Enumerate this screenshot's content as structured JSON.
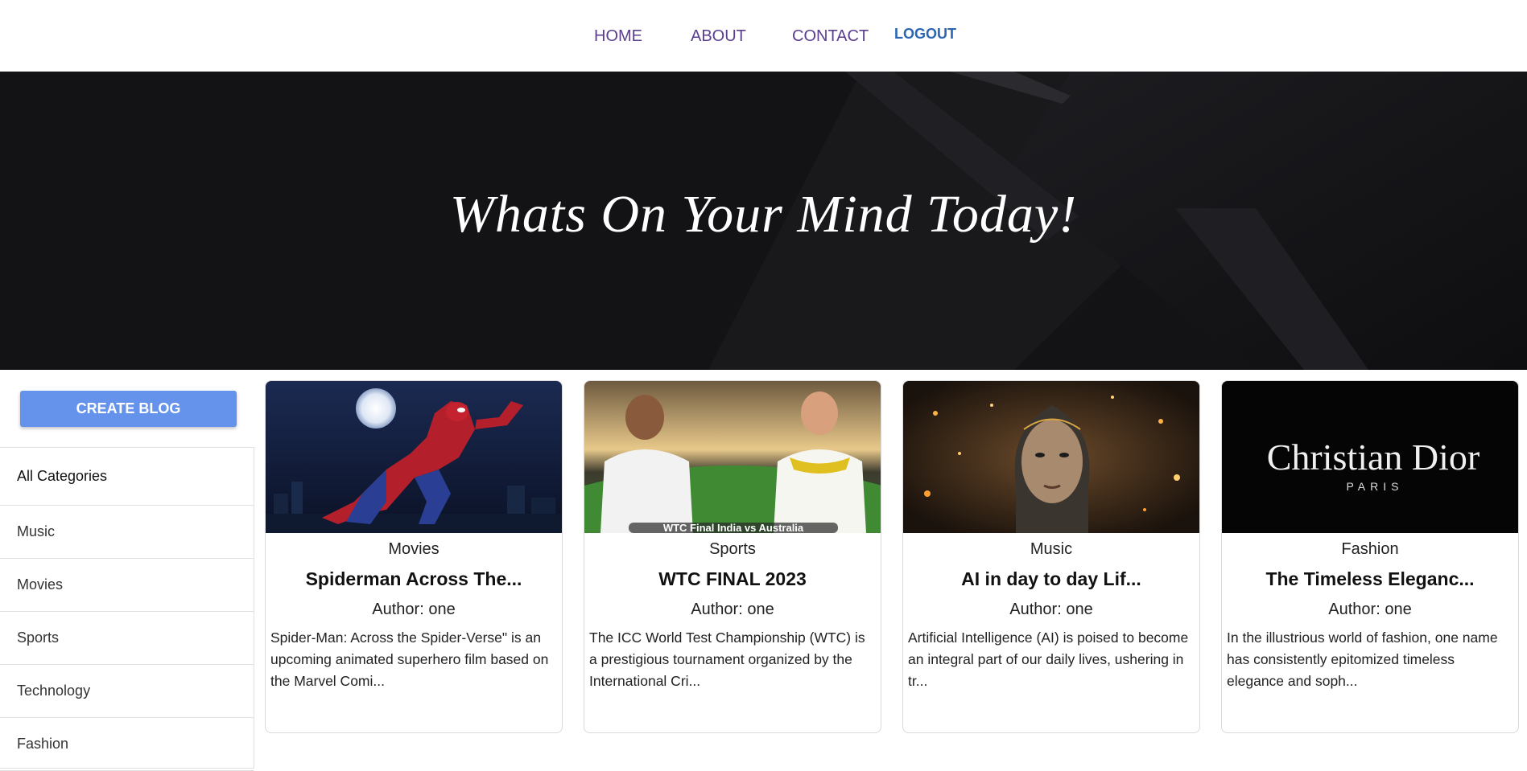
{
  "nav": {
    "home": "HOME",
    "about": "ABOUT",
    "contact": "CONTACT",
    "logout": "LOGOUT"
  },
  "banner": {
    "title": "Whats On Your Mind Today!"
  },
  "sidebar": {
    "create_button": "CREATE BLOG",
    "categories": [
      "All Categories",
      "Music",
      "Movies",
      "Sports",
      "Technology",
      "Fashion"
    ]
  },
  "cards": [
    {
      "category": "Movies",
      "title": "Spiderman Across The...",
      "author": "Author: one",
      "description": "Spider-Man: Across the Spider-Verse\" is an upcoming animated superhero film based on the Marvel Comi..."
    },
    {
      "category": "Sports",
      "title": "WTC FINAL 2023",
      "author": "Author: one",
      "description": "The ICC World Test Championship (WTC) is a prestigious tournament organized by the International Cri...",
      "image_caption": "WTC Final India vs Australia"
    },
    {
      "category": "Music",
      "title": "AI in day to day Lif...",
      "author": "Author: one",
      "description": "Artificial Intelligence (AI) is poised to become an integral part of our daily lives, ushering in tr..."
    },
    {
      "category": "Fashion",
      "title": "The Timeless Eleganc...",
      "author": "Author: one",
      "description": "In the illustrious world of fashion, one name has consistently epitomized timeless elegance and soph...",
      "image_logo": "Christian Dior",
      "image_logo_sub": "PARIS"
    }
  ],
  "colors": {
    "nav_link": "#5b3e8f",
    "logout": "#2a66b3",
    "banner_bg": "#131316",
    "create_button": "#6593eb"
  }
}
